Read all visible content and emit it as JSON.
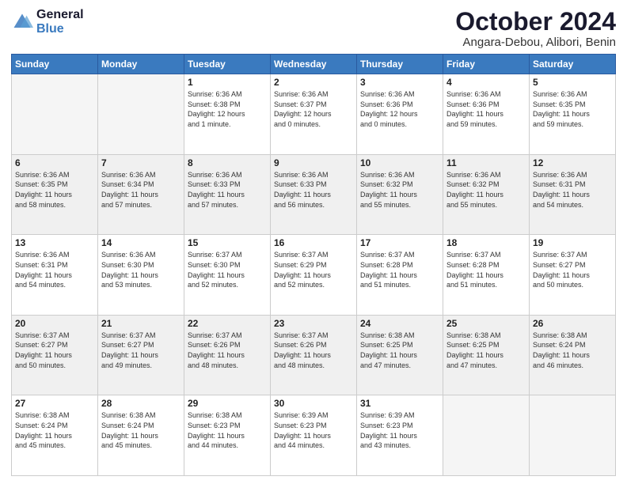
{
  "header": {
    "logo_line1": "General",
    "logo_line2": "Blue",
    "month": "October 2024",
    "location": "Angara-Debou, Alibori, Benin"
  },
  "days_of_week": [
    "Sunday",
    "Monday",
    "Tuesday",
    "Wednesday",
    "Thursday",
    "Friday",
    "Saturday"
  ],
  "weeks": [
    [
      {
        "day": "",
        "text": ""
      },
      {
        "day": "",
        "text": ""
      },
      {
        "day": "1",
        "text": "Sunrise: 6:36 AM\nSunset: 6:38 PM\nDaylight: 12 hours\nand 1 minute."
      },
      {
        "day": "2",
        "text": "Sunrise: 6:36 AM\nSunset: 6:37 PM\nDaylight: 12 hours\nand 0 minutes."
      },
      {
        "day": "3",
        "text": "Sunrise: 6:36 AM\nSunset: 6:36 PM\nDaylight: 12 hours\nand 0 minutes."
      },
      {
        "day": "4",
        "text": "Sunrise: 6:36 AM\nSunset: 6:36 PM\nDaylight: 11 hours\nand 59 minutes."
      },
      {
        "day": "5",
        "text": "Sunrise: 6:36 AM\nSunset: 6:35 PM\nDaylight: 11 hours\nand 59 minutes."
      }
    ],
    [
      {
        "day": "6",
        "text": "Sunrise: 6:36 AM\nSunset: 6:35 PM\nDaylight: 11 hours\nand 58 minutes."
      },
      {
        "day": "7",
        "text": "Sunrise: 6:36 AM\nSunset: 6:34 PM\nDaylight: 11 hours\nand 57 minutes."
      },
      {
        "day": "8",
        "text": "Sunrise: 6:36 AM\nSunset: 6:33 PM\nDaylight: 11 hours\nand 57 minutes."
      },
      {
        "day": "9",
        "text": "Sunrise: 6:36 AM\nSunset: 6:33 PM\nDaylight: 11 hours\nand 56 minutes."
      },
      {
        "day": "10",
        "text": "Sunrise: 6:36 AM\nSunset: 6:32 PM\nDaylight: 11 hours\nand 55 minutes."
      },
      {
        "day": "11",
        "text": "Sunrise: 6:36 AM\nSunset: 6:32 PM\nDaylight: 11 hours\nand 55 minutes."
      },
      {
        "day": "12",
        "text": "Sunrise: 6:36 AM\nSunset: 6:31 PM\nDaylight: 11 hours\nand 54 minutes."
      }
    ],
    [
      {
        "day": "13",
        "text": "Sunrise: 6:36 AM\nSunset: 6:31 PM\nDaylight: 11 hours\nand 54 minutes."
      },
      {
        "day": "14",
        "text": "Sunrise: 6:36 AM\nSunset: 6:30 PM\nDaylight: 11 hours\nand 53 minutes."
      },
      {
        "day": "15",
        "text": "Sunrise: 6:37 AM\nSunset: 6:30 PM\nDaylight: 11 hours\nand 52 minutes."
      },
      {
        "day": "16",
        "text": "Sunrise: 6:37 AM\nSunset: 6:29 PM\nDaylight: 11 hours\nand 52 minutes."
      },
      {
        "day": "17",
        "text": "Sunrise: 6:37 AM\nSunset: 6:28 PM\nDaylight: 11 hours\nand 51 minutes."
      },
      {
        "day": "18",
        "text": "Sunrise: 6:37 AM\nSunset: 6:28 PM\nDaylight: 11 hours\nand 51 minutes."
      },
      {
        "day": "19",
        "text": "Sunrise: 6:37 AM\nSunset: 6:27 PM\nDaylight: 11 hours\nand 50 minutes."
      }
    ],
    [
      {
        "day": "20",
        "text": "Sunrise: 6:37 AM\nSunset: 6:27 PM\nDaylight: 11 hours\nand 50 minutes."
      },
      {
        "day": "21",
        "text": "Sunrise: 6:37 AM\nSunset: 6:27 PM\nDaylight: 11 hours\nand 49 minutes."
      },
      {
        "day": "22",
        "text": "Sunrise: 6:37 AM\nSunset: 6:26 PM\nDaylight: 11 hours\nand 48 minutes."
      },
      {
        "day": "23",
        "text": "Sunrise: 6:37 AM\nSunset: 6:26 PM\nDaylight: 11 hours\nand 48 minutes."
      },
      {
        "day": "24",
        "text": "Sunrise: 6:38 AM\nSunset: 6:25 PM\nDaylight: 11 hours\nand 47 minutes."
      },
      {
        "day": "25",
        "text": "Sunrise: 6:38 AM\nSunset: 6:25 PM\nDaylight: 11 hours\nand 47 minutes."
      },
      {
        "day": "26",
        "text": "Sunrise: 6:38 AM\nSunset: 6:24 PM\nDaylight: 11 hours\nand 46 minutes."
      }
    ],
    [
      {
        "day": "27",
        "text": "Sunrise: 6:38 AM\nSunset: 6:24 PM\nDaylight: 11 hours\nand 45 minutes."
      },
      {
        "day": "28",
        "text": "Sunrise: 6:38 AM\nSunset: 6:24 PM\nDaylight: 11 hours\nand 45 minutes."
      },
      {
        "day": "29",
        "text": "Sunrise: 6:38 AM\nSunset: 6:23 PM\nDaylight: 11 hours\nand 44 minutes."
      },
      {
        "day": "30",
        "text": "Sunrise: 6:39 AM\nSunset: 6:23 PM\nDaylight: 11 hours\nand 44 minutes."
      },
      {
        "day": "31",
        "text": "Sunrise: 6:39 AM\nSunset: 6:23 PM\nDaylight: 11 hours\nand 43 minutes."
      },
      {
        "day": "",
        "text": ""
      },
      {
        "day": "",
        "text": ""
      }
    ]
  ]
}
